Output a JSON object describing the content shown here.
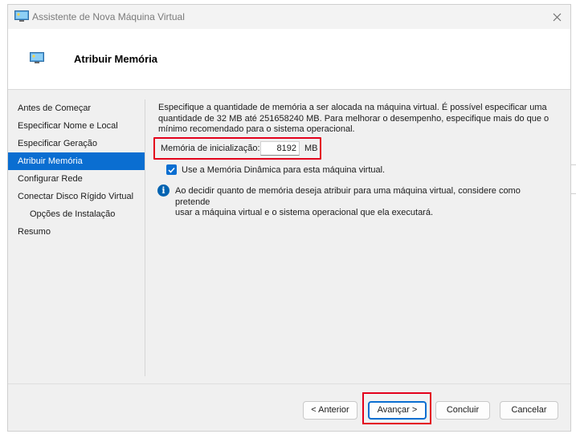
{
  "window": {
    "title": "Assistente de Nova Máquina Virtual",
    "page_title": "Atribuir Memória"
  },
  "sidebar": {
    "items": [
      {
        "label": "Antes de Começar",
        "active": false
      },
      {
        "label": "Especificar Nome e Local",
        "active": false
      },
      {
        "label": "Especificar Geração",
        "active": false
      },
      {
        "label": "Atribuir Memória",
        "active": true
      },
      {
        "label": "Configurar Rede",
        "active": false
      },
      {
        "label": "Conectar Disco Rígido Virtual",
        "active": false
      },
      {
        "label": "Opções de Instalação",
        "active": false,
        "indent": true
      },
      {
        "label": "Resumo",
        "active": false
      }
    ]
  },
  "content": {
    "description_line1": "Especifique a quantidade de memória a ser alocada na máquina virtual. É possível especificar uma",
    "description_line2": "quantidade de 32 MB até 251658240 MB. Para melhorar o desempenho, especifique mais do que o",
    "description_line3": "mínimo recomendado para o sistema operacional.",
    "memory_label": "Memória de inicialização:",
    "memory_value": "8192",
    "memory_unit": "MB",
    "dynamic_memory_label": "Use a Memória Dinâmica para esta máquina virtual.",
    "dynamic_memory_checked": true,
    "info_line1": "Ao decidir quanto de memória deseja atribuir para uma máquina virtual, considere como pretende",
    "info_line2": "usar a máquina virtual e o sistema operacional que ela executará."
  },
  "buttons": {
    "previous": "< Anterior",
    "next": "Avançar >",
    "finish": "Concluir",
    "cancel": "Cancelar"
  },
  "colors": {
    "accent": "#0a6ed1",
    "highlight": "#e3001b"
  },
  "icons": {
    "title": "vm-monitor-icon",
    "close": "close-icon",
    "info": "info-icon",
    "check": "checkmark-icon"
  }
}
